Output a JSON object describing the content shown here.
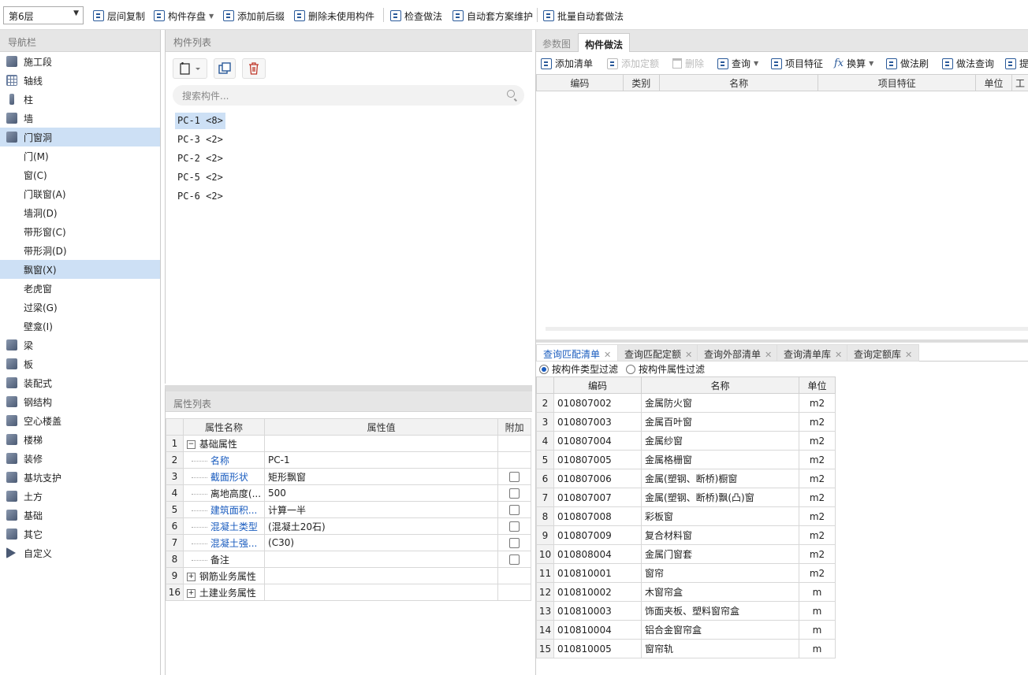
{
  "toolbar": {
    "floor": "第6层",
    "buttons": [
      "层间复制",
      "构件存盘",
      "添加前后缀",
      "删除未使用构件",
      "检查做法",
      "自动套方案维护",
      "批量自动套做法"
    ]
  },
  "nav": {
    "title": "导航栏",
    "items": [
      {
        "label": "施工段",
        "icon": "cube-icon",
        "sub": false
      },
      {
        "label": "轴线",
        "icon": "grid-icon",
        "sub": false
      },
      {
        "label": "柱",
        "icon": "column-icon",
        "sub": false
      },
      {
        "label": "墙",
        "icon": "wall-icon",
        "sub": false
      },
      {
        "label": "门窗洞",
        "icon": "door-window-icon",
        "sub": false,
        "selected": true
      },
      {
        "label": "门(M)",
        "sub": true
      },
      {
        "label": "窗(C)",
        "sub": true
      },
      {
        "label": "门联窗(A)",
        "sub": true
      },
      {
        "label": "墙洞(D)",
        "sub": true
      },
      {
        "label": "带形窗(C)",
        "sub": true
      },
      {
        "label": "带形洞(D)",
        "sub": true
      },
      {
        "label": "飘窗(X)",
        "sub": true,
        "selected": true
      },
      {
        "label": "老虎窗",
        "sub": true
      },
      {
        "label": "过梁(G)",
        "sub": true
      },
      {
        "label": "壁龛(I)",
        "sub": true
      },
      {
        "label": "梁",
        "icon": "beam-icon",
        "sub": false
      },
      {
        "label": "板",
        "icon": "slab-icon",
        "sub": false
      },
      {
        "label": "装配式",
        "icon": "prefab-icon",
        "sub": false
      },
      {
        "label": "钢结构",
        "icon": "steel-icon",
        "sub": false
      },
      {
        "label": "空心楼盖",
        "icon": "hollow-floor-icon",
        "sub": false
      },
      {
        "label": "楼梯",
        "icon": "stairs-icon",
        "sub": false
      },
      {
        "label": "装修",
        "icon": "decoration-icon",
        "sub": false
      },
      {
        "label": "基坑支护",
        "icon": "pit-support-icon",
        "sub": false
      },
      {
        "label": "土方",
        "icon": "earthwork-icon",
        "sub": false
      },
      {
        "label": "基础",
        "icon": "foundation-icon",
        "sub": false
      },
      {
        "label": "其它",
        "icon": "other-icon",
        "sub": false
      },
      {
        "label": "自定义",
        "icon": "custom-icon",
        "sub": false
      }
    ]
  },
  "components": {
    "title": "构件列表",
    "search_placeholder": "搜索构件...",
    "items": [
      "PC-1 <8>",
      "PC-3 <2>",
      "PC-2 <2>",
      "PC-5 <2>",
      "PC-6 <2>"
    ]
  },
  "properties": {
    "title": "属性列表",
    "headers": [
      "属性名称",
      "属性值",
      "附加"
    ],
    "rows": [
      {
        "num": "1",
        "name": "基础属性",
        "value": "",
        "group": true,
        "expand": "−"
      },
      {
        "num": "2",
        "name": "名称",
        "value": "PC-1",
        "blue": true,
        "check": false
      },
      {
        "num": "3",
        "name": "截面形状",
        "value": "矩形飘窗",
        "blue": true,
        "check": true
      },
      {
        "num": "4",
        "name": "离地高度(...",
        "value": "500",
        "blue": false,
        "check": true
      },
      {
        "num": "5",
        "name": "建筑面积...",
        "value": "计算一半",
        "blue": true,
        "check": true
      },
      {
        "num": "6",
        "name": "混凝土类型",
        "value": "(混凝土20石)",
        "blue": true,
        "check": true
      },
      {
        "num": "7",
        "name": "混凝土强...",
        "value": "(C30)",
        "blue": true,
        "check": true
      },
      {
        "num": "8",
        "name": "备注",
        "value": "",
        "blue": false,
        "check": true
      },
      {
        "num": "9",
        "name": "钢筋业务属性",
        "value": "",
        "group": true,
        "expand": "+"
      },
      {
        "num": "16",
        "name": "土建业务属性",
        "value": "",
        "group": true,
        "expand": "+"
      }
    ]
  },
  "right": {
    "tabs": [
      "参数图",
      "构件做法"
    ],
    "toolbar": [
      "添加清单",
      "添加定额",
      "删除",
      "查询",
      "项目特征",
      "换算",
      "做法刷",
      "做法查询",
      "提"
    ],
    "headers": [
      "编码",
      "类别",
      "名称",
      "项目特征",
      "单位",
      "工"
    ],
    "bottom_tabs": [
      "查询匹配清单",
      "查询匹配定额",
      "查询外部清单",
      "查询清单库",
      "查询定额库"
    ],
    "filters": [
      "按构件类型过滤",
      "按构件属性过滤"
    ],
    "query_headers": [
      "编码",
      "名称",
      "单位"
    ],
    "query_rows": [
      [
        "2",
        "010807002",
        "金属防火窗",
        "m2"
      ],
      [
        "3",
        "010807003",
        "金属百叶窗",
        "m2"
      ],
      [
        "4",
        "010807004",
        "金属纱窗",
        "m2"
      ],
      [
        "5",
        "010807005",
        "金属格栅窗",
        "m2"
      ],
      [
        "6",
        "010807006",
        "金属(塑钢、断桥)橱窗",
        "m2"
      ],
      [
        "7",
        "010807007",
        "金属(塑钢、断桥)飘(凸)窗",
        "m2"
      ],
      [
        "8",
        "010807008",
        "彩板窗",
        "m2"
      ],
      [
        "9",
        "010807009",
        "复合材料窗",
        "m2"
      ],
      [
        "10",
        "010808004",
        "金属门窗套",
        "m2"
      ],
      [
        "11",
        "010810001",
        "窗帘",
        "m2"
      ],
      [
        "12",
        "010810002",
        "木窗帘盒",
        "m"
      ],
      [
        "13",
        "010810003",
        "饰面夹板、塑料窗帘盒",
        "m"
      ],
      [
        "14",
        "010810004",
        "铝合金窗帘盒",
        "m"
      ],
      [
        "15",
        "010810005",
        "窗帘轨",
        "m"
      ]
    ]
  }
}
